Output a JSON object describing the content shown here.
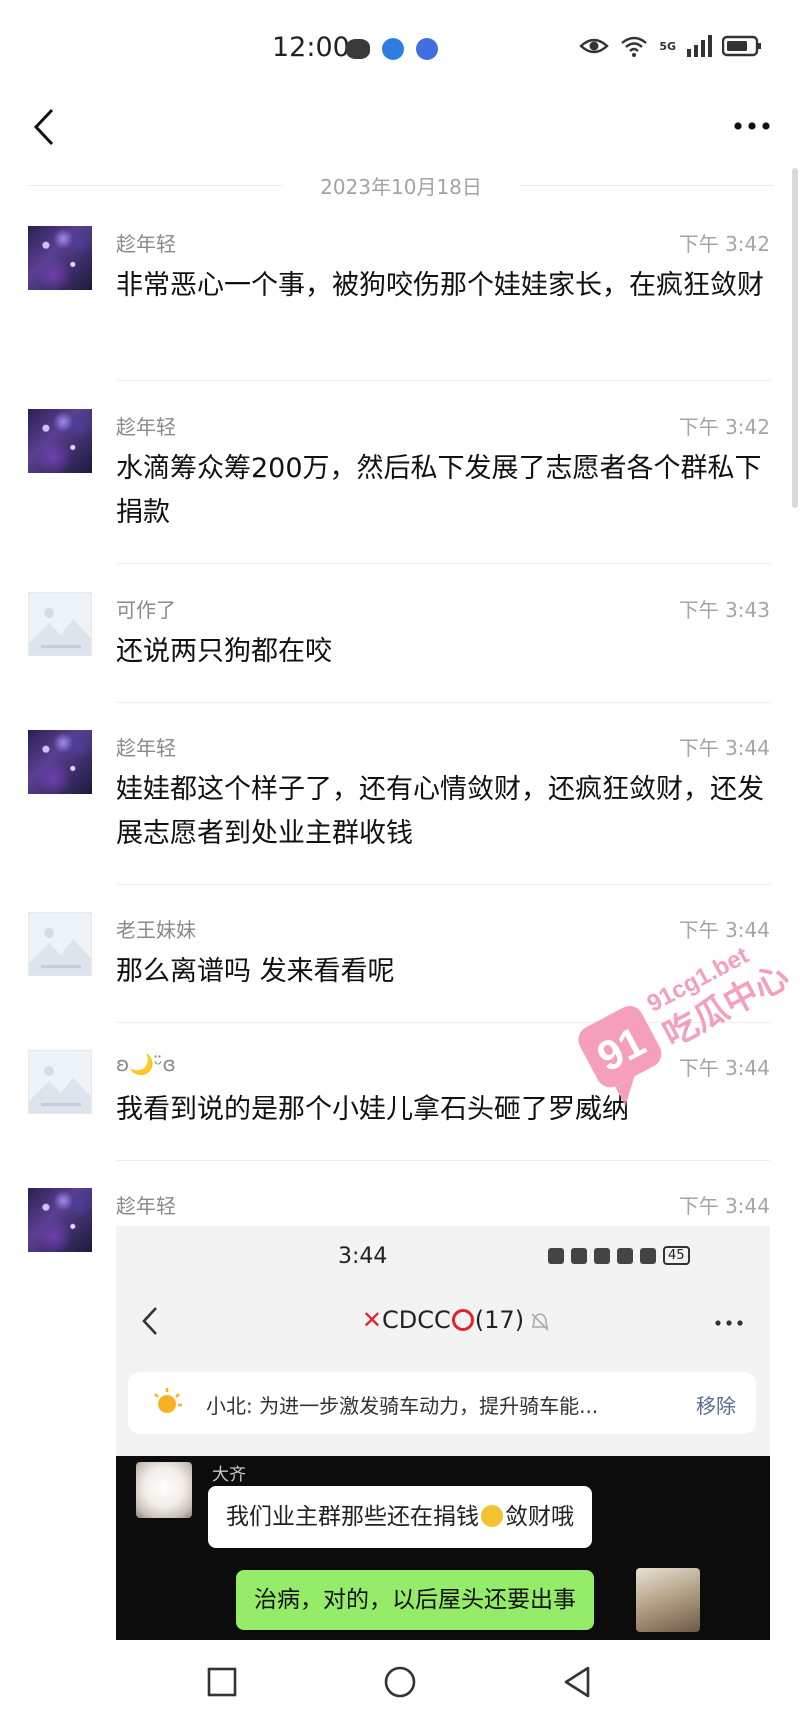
{
  "status_bar": {
    "time": "12:00",
    "network_label": "5G"
  },
  "header": {
    "back_icon": "chevron-left-icon",
    "more_icon": "more-dots-icon"
  },
  "date_divider": "2023年10月18日",
  "messages": [
    {
      "sender": "趁年轻",
      "time": "下午 3:42",
      "text": "非常恶心一个事，被狗咬伤那个娃娃家长，在疯狂敛财",
      "avatar": "galaxy"
    },
    {
      "sender": "趁年轻",
      "time": "下午 3:42",
      "text": "水滴筹众筹200万，然后私下发展了志愿者各个群私下捐款",
      "avatar": "galaxy"
    },
    {
      "sender": "可作了",
      "time": "下午 3:43",
      "text": "还说两只狗都在咬",
      "avatar": "placeholder"
    },
    {
      "sender": "趁年轻",
      "time": "下午 3:44",
      "text": "娃娃都这个样子了，还有心情敛财，还疯狂敛财，还发展志愿者到处业主群收钱",
      "avatar": "galaxy"
    },
    {
      "sender": "老王妹妹",
      "time": "下午 3:44",
      "text": "那么离谱吗 发来看看呢",
      "avatar": "placeholder"
    },
    {
      "sender": "ʚ🌙ᵕ̈ɞ",
      "time": "下午 3:44",
      "text": "我看到说的是那个小娃儿拿石头砸了罗威纳",
      "avatar": "placeholder"
    },
    {
      "sender": "趁年轻",
      "time": "下午 3:44",
      "text": "",
      "avatar": "galaxy"
    }
  ],
  "embedded_screenshot": {
    "time": "3:44",
    "battery": "45",
    "group_title_mid": "CDCC",
    "group_count": "(17)",
    "notice_text": "小北: 为进一步激发骑车动力，提升骑车能...",
    "notice_action": "移除",
    "bubble_sender": "大齐",
    "bubble_text_a": "我们业主群那些还在捐钱",
    "bubble_text_b": "敛财哦",
    "reply_text": "治病，对的，以后屋头还要出事"
  },
  "watermark": {
    "site": "91cg1.bet",
    "name": "吃瓜中心",
    "badge": "91",
    "color": "#f48fb1"
  },
  "colors": {
    "accent_link": "#576b95",
    "bubble_green": "#95ec69",
    "title_red": "#e0242b"
  }
}
